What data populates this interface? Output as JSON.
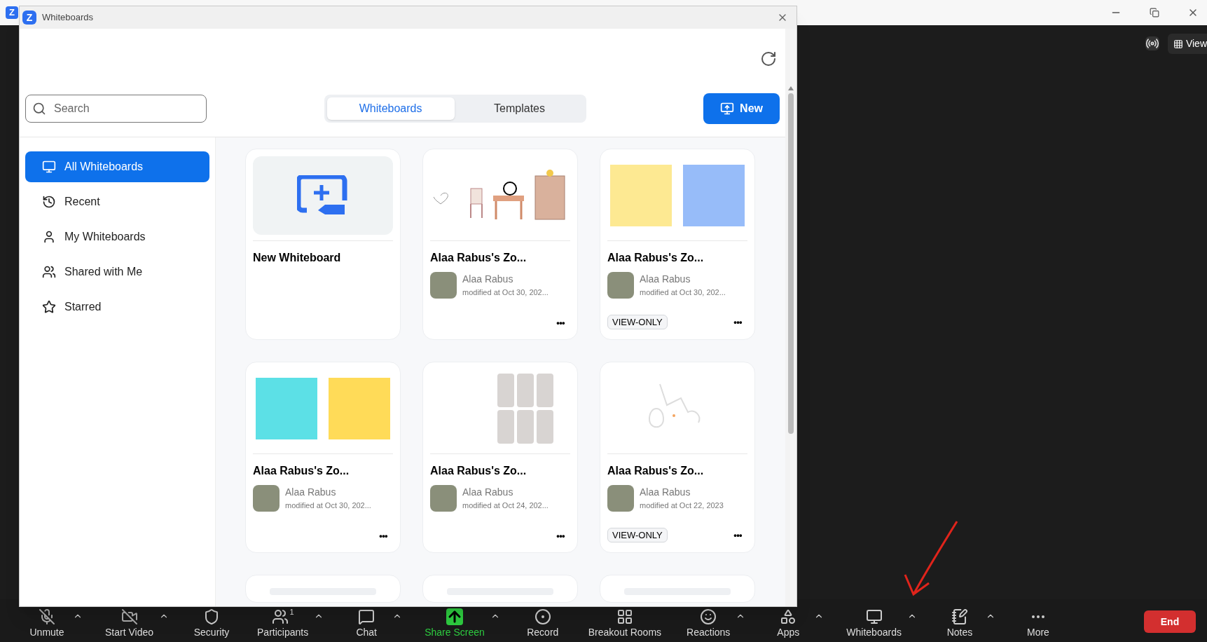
{
  "app_bar": {
    "logo": "Z",
    "view_label": "View"
  },
  "dialog": {
    "title": "Whiteboards",
    "logo": "Z",
    "search": {
      "placeholder": "Search"
    },
    "tabs": [
      {
        "label": "Whiteboards",
        "selected": true
      },
      {
        "label": "Templates",
        "selected": false
      }
    ],
    "new_button": "New",
    "sidebar": [
      {
        "label": "All Whiteboards",
        "selected": true
      },
      {
        "label": "Recent",
        "selected": false
      },
      {
        "label": "My Whiteboards",
        "selected": false
      },
      {
        "label": "Shared with Me",
        "selected": false
      },
      {
        "label": "Starred",
        "selected": false
      }
    ],
    "cards": [
      {
        "kind": "new",
        "title": "New Whiteboard"
      },
      {
        "kind": "furniture",
        "title": "Alaa Rabus's Zo...",
        "owner": "Alaa Rabus",
        "modified": "modified at Oct 30, 202...",
        "view_only": false,
        "menu": "•••"
      },
      {
        "kind": "notes",
        "notes": [
          {
            "color": "#fde992"
          },
          {
            "color": "#97bcf9"
          }
        ],
        "title": "Alaa Rabus's Zo...",
        "owner": "Alaa Rabus",
        "modified": "modified at Oct 30, 202...",
        "view_only": true,
        "badge": "VIEW-ONLY",
        "menu": "•••"
      },
      {
        "kind": "notes",
        "notes": [
          {
            "color": "#5ce0e6"
          },
          {
            "color": "#ffdb58"
          }
        ],
        "title": "Alaa Rabus's Zo...",
        "owner": "Alaa Rabus",
        "modified": "modified at Oct 30, 202...",
        "view_only": false,
        "menu": "•••"
      },
      {
        "kind": "photos",
        "title": "Alaa Rabus's Zo...",
        "owner": "Alaa Rabus",
        "modified": "modified at Oct 24, 202...",
        "view_only": false,
        "menu": "•••"
      },
      {
        "kind": "sketch",
        "title": "Alaa Rabus's Zo...",
        "owner": "Alaa Rabus",
        "modified": "modified at Oct 22, 2023",
        "view_only": true,
        "badge": "VIEW-ONLY",
        "menu": "•••"
      },
      {
        "kind": "partial"
      },
      {
        "kind": "partial"
      },
      {
        "kind": "partial"
      }
    ]
  },
  "toolbar": [
    {
      "label": "Unmute",
      "caret": true
    },
    {
      "label": "Start Video",
      "caret": true
    },
    {
      "label": "Security",
      "caret": false
    },
    {
      "label": "Participants",
      "caret": true,
      "count": "1"
    },
    {
      "label": "Chat",
      "caret": true
    },
    {
      "label": "Share Screen",
      "caret": true
    },
    {
      "label": "Record",
      "caret": false
    },
    {
      "label": "Breakout Rooms",
      "caret": false
    },
    {
      "label": "Reactions",
      "caret": true
    },
    {
      "label": "Apps",
      "caret": true
    },
    {
      "label": "Whiteboards",
      "caret": true
    },
    {
      "label": "Notes",
      "caret": true
    },
    {
      "label": "More",
      "caret": false
    }
  ],
  "end_button": "End"
}
